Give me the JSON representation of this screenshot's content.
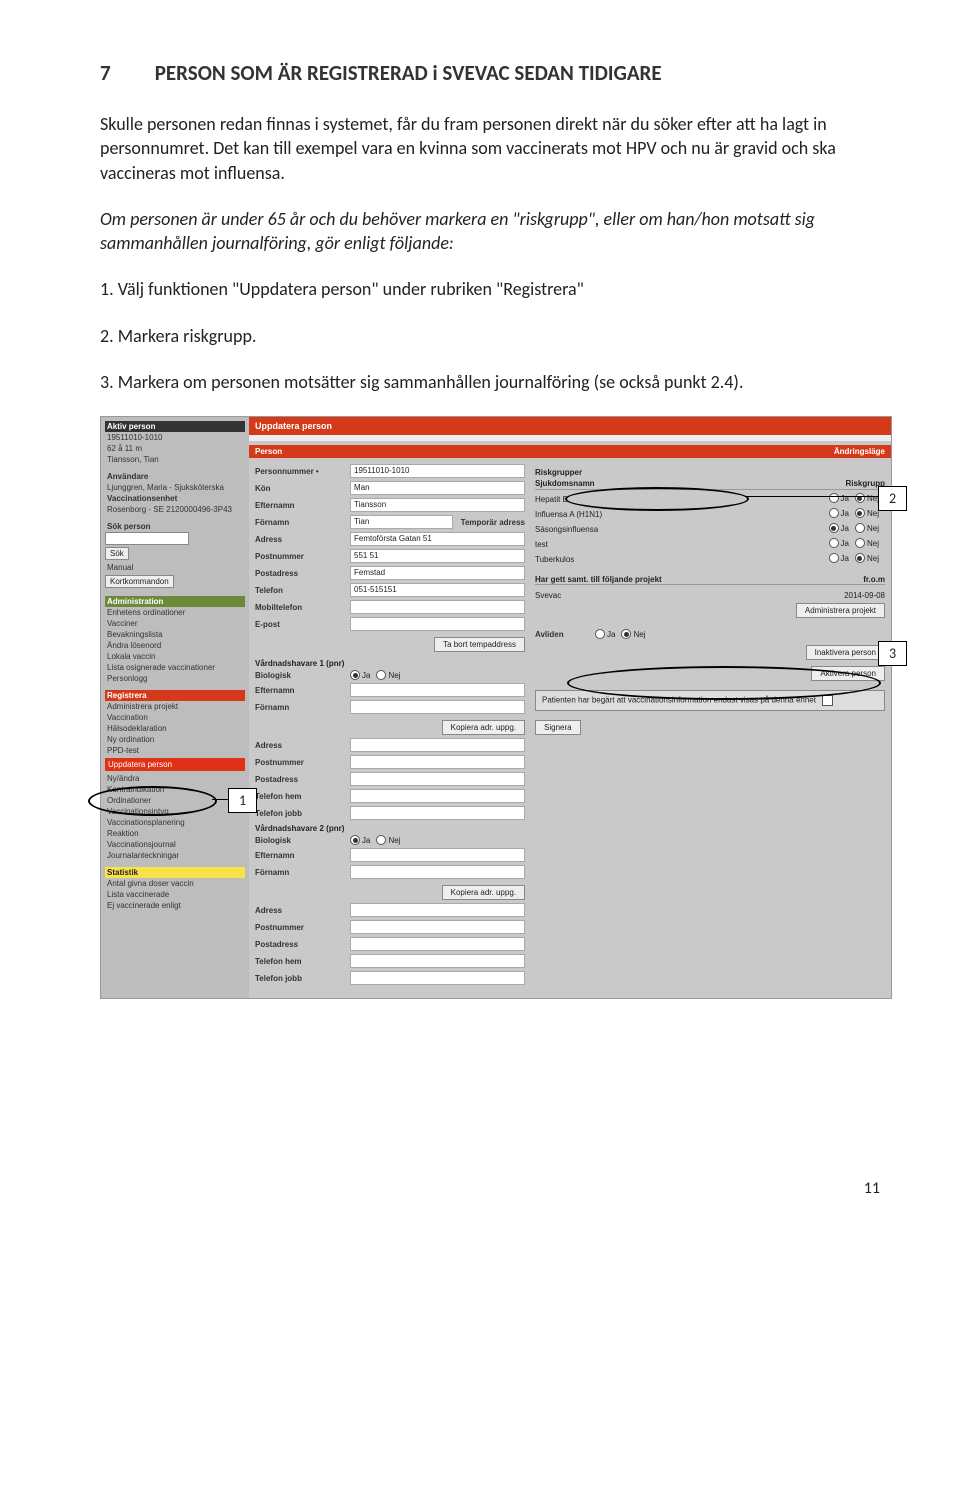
{
  "heading": {
    "num": "7",
    "title": "PERSON SOM ÄR REGISTRERAD i SVEVAC SEDAN TIDIGARE"
  },
  "p1": "Skulle personen redan finnas i systemet, får du fram personen direkt när du söker efter att ha lagt in personnumret. Det kan till exempel vara en kvinna som vaccinerats mot HPV och nu är gravid och ska vaccineras mot influensa.",
  "p2": "Om personen är under 65 år och du behöver markera en \"riskgrupp\", eller om han/hon motsatt sig sammanhållen journalföring, gör enligt följande:",
  "l1": "1. Välj funktionen \"Uppdatera person\" under rubriken \"Registrera\"",
  "l2": "2. Markera riskgrupp.",
  "l3": "3. Markera om personen motsätter sig sammanhållen journalföring (se också punkt 2.4).",
  "sidebar": {
    "aktiv_head": "Aktiv person",
    "aktiv_pnr": "19511010-1010",
    "aktiv_age": "62 å 11 m",
    "aktiv_name": "Tiansson, Tian",
    "anv_head": "Användare",
    "anv_name": "Ljunggren, Maria - Sjuksköterska",
    "ve_head": "Vaccinationsenhet",
    "ve_name": "Rosenborg - SE 2120000496-3P43",
    "sok_head": "Sök person",
    "sok_btn": "Sök",
    "manual": "Manual",
    "kort": "Kortkommandon",
    "admin_head": "Administration",
    "admin_items": [
      "Enhetens ordinationer",
      "Vacciner",
      "Bevakningslista",
      "Ändra lösenord",
      "Lokala vaccin",
      "Lista osignerade vaccinationer",
      "Personlogg"
    ],
    "reg_head": "Registrera",
    "reg_items_a": [
      "Administrera projekt",
      "Vaccination",
      "Hälsodeklaration",
      "Ny ordination",
      "PPD-test"
    ],
    "reg_upd": "Uppdatera person",
    "reg_ny": "Ny/ändra",
    "reg_items_b": [
      "Kontraindikation",
      "Ordinationer",
      "Vaccinationsintyg",
      "Vaccinationsplanering",
      "Reaktion",
      "Vaccinationsjournal",
      "Journalanteckningar"
    ],
    "stat_head": "Statistik",
    "stat_items": [
      "Antal givna doser vaccin",
      "Lista vaccinerade",
      "Ej vaccinerade enligt"
    ]
  },
  "main": {
    "tab": "Uppdatera person",
    "sub_person": "Person",
    "sub_andr": "Ändringsläge",
    "fields": {
      "pnr_l": "Personnummer  •",
      "pnr_v": "19511010-1010",
      "kon_l": "Kön",
      "kon_v": "Man",
      "eft_l": "Efternamn",
      "eft_v": "Tiansson",
      "for_l": "Förnamn",
      "for_v": "Tian",
      "adr_l": "Adress",
      "adr_v": "Femtoförsta Gatan 51",
      "pnm_l": "Postnummer",
      "pnm_v": "551 51",
      "pad_l": "Postadress",
      "pad_v": "Femstad",
      "tel_l": "Telefon",
      "tel_v": "051-515151",
      "mob_l": "Mobiltelefon",
      "mob_v": "",
      "ep_l": "E-post",
      "ep_v": "",
      "temp_l": "Temporär adress",
      "temp_btn": "Ta bort tempaddress",
      "v1_head": "Vårdnadshavare 1 (pnr)",
      "v2_head": "Vårdnadshavare 2 (pnr)",
      "bio_l": "Biologisk",
      "kop_btn": "Kopiera adr. uppg.",
      "th_l": "Telefon hem",
      "tj_l": "Telefon jobb",
      "ja": "Ja",
      "nej": "Nej"
    },
    "risk": {
      "head1": "Riskgrupper",
      "col1": "Sjukdomsnamn",
      "col2": "Riskgrupp",
      "rows": [
        {
          "n": "Hepatit B",
          "sel": "nej"
        },
        {
          "n": "Influensa A (H1N1)",
          "sel": "nej"
        },
        {
          "n": "Säsongsinfluensa",
          "sel": "ja"
        },
        {
          "n": "test",
          "sel": ""
        },
        {
          "n": "Tuberkulos",
          "sel": "nej"
        }
      ],
      "samt": "Har gett samt. till följande projekt",
      "from": "fr.o.m",
      "proj": "Svevac",
      "date": "2014-09-08",
      "adm": "Administrera projekt",
      "avl": "Avliden",
      "inakt": "Inaktivera person",
      "akt": "Aktivera person",
      "note": "Patienten har begärt att vaccinationsinformation endast visas på denna enhet",
      "sign": "Signera"
    }
  },
  "callouts": {
    "c1": "1",
    "c2": "2",
    "c3": "3"
  },
  "pagenum": "11"
}
